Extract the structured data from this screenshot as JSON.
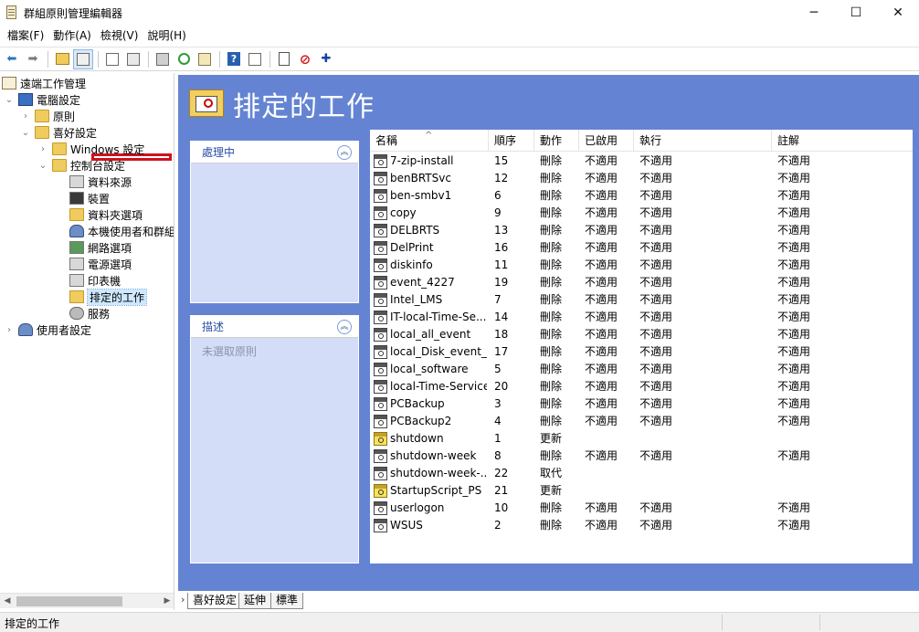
{
  "window": {
    "title": "群組原則管理編輯器",
    "minimize_icon": "─",
    "maximize_icon": "☐",
    "close_icon": "✕"
  },
  "menu": [
    "檔案(F)",
    "動作(A)",
    "檢視(V)",
    "說明(H)"
  ],
  "toolbar": {
    "back_icon": "⬅",
    "forward_icon": "➡",
    "up_icon": "▲",
    "help_icon": "?",
    "stop_icon": "⊘",
    "add_icon": "✚"
  },
  "tree": {
    "root": "遠端工作管理",
    "items": [
      {
        "label": "電腦設定",
        "expander": "⌄"
      },
      {
        "label": "原則",
        "expander": "›"
      },
      {
        "label": "喜好設定",
        "expander": "⌄"
      },
      {
        "label": "Windows 設定",
        "expander": "›"
      },
      {
        "label": "控制台設定",
        "expander": "⌄"
      },
      {
        "label": "資料來源",
        "expander": ""
      },
      {
        "label": "裝置",
        "expander": ""
      },
      {
        "label": "資料夾選項",
        "expander": ""
      },
      {
        "label": "本機使用者和群組",
        "expander": ""
      },
      {
        "label": "網路選項",
        "expander": ""
      },
      {
        "label": "電源選項",
        "expander": ""
      },
      {
        "label": "印表機",
        "expander": ""
      },
      {
        "label": "排定的工作",
        "expander": ""
      },
      {
        "label": "服務",
        "expander": ""
      },
      {
        "label": "使用者設定",
        "expander": "›"
      }
    ]
  },
  "content": {
    "title": "排定的工作",
    "processing_panel": {
      "title": "處理中",
      "collapse_icon": "︽"
    },
    "description_panel": {
      "title": "描述",
      "body": "未選取原則",
      "collapse_icon": "︽"
    },
    "list": {
      "sort_indicator": "^",
      "columns": [
        "名稱",
        "順序",
        "動作",
        "已啟用",
        "執行",
        "註解"
      ],
      "rows": [
        {
          "name": "7-zip-install",
          "order": "15",
          "action": "刪除",
          "enabled": "不適用",
          "run": "不適用",
          "comment": "不適用",
          "warn": false
        },
        {
          "name": "benBRTSvc",
          "order": "12",
          "action": "刪除",
          "enabled": "不適用",
          "run": "不適用",
          "comment": "不適用",
          "warn": false
        },
        {
          "name": "ben-smbv1",
          "order": "6",
          "action": "刪除",
          "enabled": "不適用",
          "run": "不適用",
          "comment": "不適用",
          "warn": false
        },
        {
          "name": "copy",
          "order": "9",
          "action": "刪除",
          "enabled": "不適用",
          "run": "不適用",
          "comment": "不適用",
          "warn": false
        },
        {
          "name": "DELBRTS",
          "order": "13",
          "action": "刪除",
          "enabled": "不適用",
          "run": "不適用",
          "comment": "不適用",
          "warn": false
        },
        {
          "name": "DelPrint",
          "order": "16",
          "action": "刪除",
          "enabled": "不適用",
          "run": "不適用",
          "comment": "不適用",
          "warn": false
        },
        {
          "name": "diskinfo",
          "order": "11",
          "action": "刪除",
          "enabled": "不適用",
          "run": "不適用",
          "comment": "不適用",
          "warn": false
        },
        {
          "name": "event_4227",
          "order": "19",
          "action": "刪除",
          "enabled": "不適用",
          "run": "不適用",
          "comment": "不適用",
          "warn": false
        },
        {
          "name": "Intel_LMS",
          "order": "7",
          "action": "刪除",
          "enabled": "不適用",
          "run": "不適用",
          "comment": "不適用",
          "warn": false
        },
        {
          "name": "IT-local-Time-Se...",
          "order": "14",
          "action": "刪除",
          "enabled": "不適用",
          "run": "不適用",
          "comment": "不適用",
          "warn": false
        },
        {
          "name": "local_all_event",
          "order": "18",
          "action": "刪除",
          "enabled": "不適用",
          "run": "不適用",
          "comment": "不適用",
          "warn": false
        },
        {
          "name": "local_Disk_event_...",
          "order": "17",
          "action": "刪除",
          "enabled": "不適用",
          "run": "不適用",
          "comment": "不適用",
          "warn": false
        },
        {
          "name": "local_software",
          "order": "5",
          "action": "刪除",
          "enabled": "不適用",
          "run": "不適用",
          "comment": "不適用",
          "warn": false
        },
        {
          "name": "local-Time-Service",
          "order": "20",
          "action": "刪除",
          "enabled": "不適用",
          "run": "不適用",
          "comment": "不適用",
          "warn": false
        },
        {
          "name": "PCBackup",
          "order": "3",
          "action": "刪除",
          "enabled": "不適用",
          "run": "不適用",
          "comment": "不適用",
          "warn": false
        },
        {
          "name": "PCBackup2",
          "order": "4",
          "action": "刪除",
          "enabled": "不適用",
          "run": "不適用",
          "comment": "不適用",
          "warn": false
        },
        {
          "name": "shutdown",
          "order": "1",
          "action": "更新",
          "enabled": "",
          "run": "",
          "comment": "",
          "warn": true
        },
        {
          "name": "shutdown-week",
          "order": "8",
          "action": "刪除",
          "enabled": "不適用",
          "run": "不適用",
          "comment": "不適用",
          "warn": false
        },
        {
          "name": "shutdown-week-...",
          "order": "22",
          "action": "取代",
          "enabled": "",
          "run": "",
          "comment": "",
          "warn": false
        },
        {
          "name": "StartupScript_PS",
          "order": "21",
          "action": "更新",
          "enabled": "",
          "run": "",
          "comment": "",
          "warn": true
        },
        {
          "name": "userlogon",
          "order": "10",
          "action": "刪除",
          "enabled": "不適用",
          "run": "不適用",
          "comment": "不適用",
          "warn": false
        },
        {
          "name": "WSUS",
          "order": "2",
          "action": "刪除",
          "enabled": "不適用",
          "run": "不適用",
          "comment": "不適用",
          "warn": false
        }
      ]
    }
  },
  "tabs": {
    "nav": "›",
    "items": [
      "喜好設定",
      "延伸",
      "標準"
    ]
  },
  "status": {
    "text": "排定的工作"
  }
}
